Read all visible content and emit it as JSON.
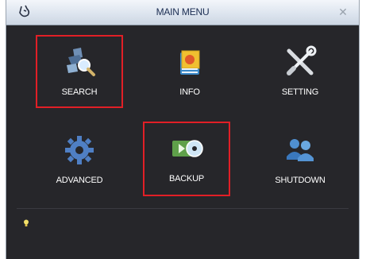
{
  "window": {
    "title": "MAIN MENU"
  },
  "menu": {
    "items": [
      {
        "id": "search",
        "label": "SEARCH",
        "icon": "search-icon",
        "highlighted": true
      },
      {
        "id": "info",
        "label": "INFO",
        "icon": "info-icon",
        "highlighted": false
      },
      {
        "id": "setting",
        "label": "SETTING",
        "icon": "setting-tools-icon",
        "highlighted": false
      },
      {
        "id": "advanced",
        "label": "ADVANCED",
        "icon": "gear-icon",
        "highlighted": false
      },
      {
        "id": "backup",
        "label": "BACKUP",
        "icon": "backup-disc-icon",
        "highlighted": true
      },
      {
        "id": "shutdown",
        "label": "SHUTDOWN",
        "icon": "shutdown-users-icon",
        "highlighted": false
      }
    ]
  },
  "colors": {
    "background": "#26262a",
    "highlight_border": "#e11f26",
    "label": "#ffffff",
    "title_text": "#1b2d52"
  }
}
